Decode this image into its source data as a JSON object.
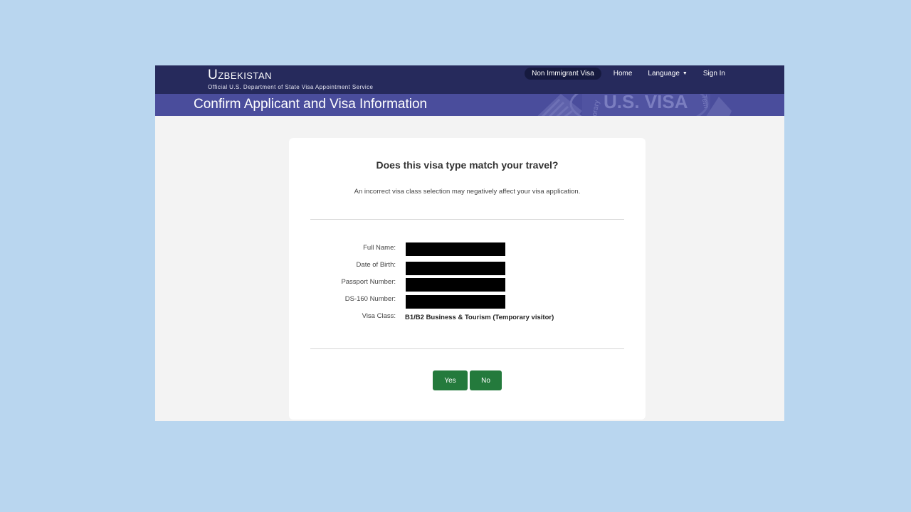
{
  "header": {
    "brand_title": "Uzbekistan",
    "brand_subtitle": "Official U.S. Department of State Visa Appointment Service",
    "nav": {
      "visa_type": "Non Immigrant Visa",
      "home": "Home",
      "language": "Language",
      "sign_in": "Sign In"
    }
  },
  "subheader": {
    "title": "Confirm Applicant and Visa Information",
    "seal_text": "U.S. VISA",
    "seal_side_left": "orary",
    "seal_side_right": "Tem"
  },
  "card": {
    "question": "Does this visa type match your travel?",
    "notice": "An incorrect visa class selection may negatively affect your visa application.",
    "fields": [
      {
        "label": "Full Name:",
        "value": ""
      },
      {
        "label": "Date of Birth:",
        "value": ""
      },
      {
        "label": "Passport Number:",
        "value": ""
      },
      {
        "label": "DS-160 Number:",
        "value": ""
      }
    ],
    "visa_class_label": "Visa Class:",
    "visa_class_value": "B1/B2 Business & Tourism (Temporary visitor)",
    "yes_label": "Yes",
    "no_label": "No"
  },
  "colors": {
    "page_background": "#b9d6ef",
    "topbar": "#262a5c",
    "subbar": "#4a4d9c",
    "button": "#247a3c"
  }
}
